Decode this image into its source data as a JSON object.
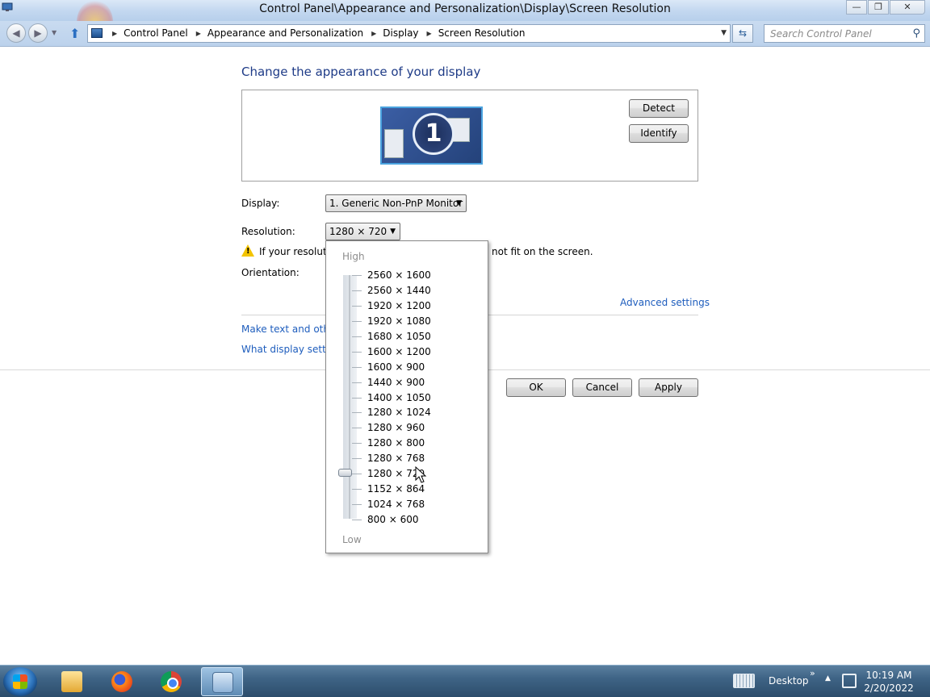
{
  "window": {
    "title": "Control Panel\\Appearance and Personalization\\Display\\Screen Resolution",
    "controls": {
      "minimize": "—",
      "maximize": "❐",
      "close": "✕"
    }
  },
  "address_bar": {
    "crumbs": [
      "Control Panel",
      "Appearance and Personalization",
      "Display",
      "Screen Resolution"
    ],
    "search_placeholder": "Search Control Panel"
  },
  "page": {
    "heading": "Change the appearance of your display",
    "monitor_number": "1",
    "detect_label": "Detect",
    "identify_label": "Identify",
    "display_label": "Display:",
    "display_value": "1. Generic Non-PnP Monitor",
    "resolution_label": "Resolution:",
    "resolution_value": "1280 × 720",
    "warning_left": "If your resolutio",
    "warning_right": "not fit on the screen.",
    "orientation_label": "Orientation:",
    "advanced_link": "Advanced settings",
    "link_text_size": "Make text and other",
    "link_display_settings": "What display setting",
    "ok_label": "OK",
    "cancel_label": "Cancel",
    "apply_label": "Apply"
  },
  "resolution_dropdown": {
    "high_label": "High",
    "low_label": "Low",
    "options": [
      "2560 × 1600",
      "2560 × 1440",
      "1920 × 1200",
      "1920 × 1080",
      "1680 × 1050",
      "1600 × 1200",
      "1600 × 900",
      "1440 × 900",
      "1400 × 1050",
      "1280 × 1024",
      "1280 × 960",
      "1280 × 800",
      "1280 × 768",
      "1280 × 720",
      "1152 × 864",
      "1024 × 768",
      "800 × 600"
    ],
    "selected": "1280 × 720"
  },
  "taskbar": {
    "desktop_label": "Desktop",
    "time": "10:19 AM",
    "date": "2/20/2022",
    "apps": [
      "start-button",
      "file-explorer",
      "firefox",
      "chrome",
      "control-panel"
    ]
  }
}
